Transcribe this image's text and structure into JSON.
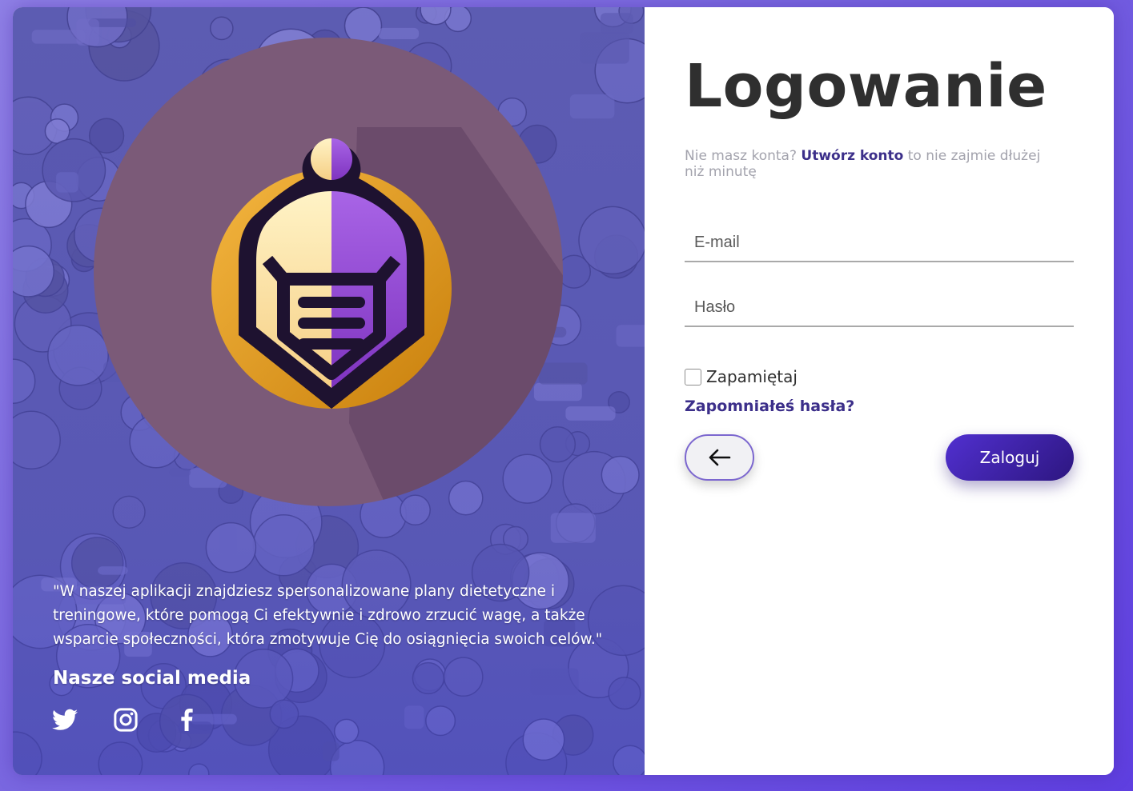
{
  "login": {
    "title": "Logowanie",
    "subtitle_prefix": "Nie masz konta?",
    "create_account_link": "Utwórz konto",
    "subtitle_suffix": "to nie zajmie dłużej niż minutę",
    "email_placeholder": "E-mail",
    "password_placeholder": "Hasło",
    "remember_label": "Zapamiętaj",
    "forgot_password": "Zapomniałeś hasła?",
    "submit_label": "Zaloguj",
    "back_icon": "arrow-left-icon"
  },
  "promo": {
    "quote": "\"W naszej aplikacji znajdziesz spersonalizowane plany dietetyczne i treningowe, które pomogą Ci efektywnie i zdrowo zrzucić wagę, a także wsparcie społeczności, która zmotywuje Cię do osiągnięcia swoich celów.\"",
    "social_title": "Nasze social media",
    "social_icons": [
      "twitter-icon",
      "instagram-icon",
      "facebook-icon"
    ]
  },
  "colors": {
    "accent": "#3c2f8a",
    "button_gradient_start": "#5130d0",
    "button_gradient_end": "#2d1680",
    "panel_bg": "#5d5cb0",
    "logo_circle": "#7b5a78",
    "logo_gold": "#e09a1c",
    "logo_purple": "#9a4fd6"
  }
}
